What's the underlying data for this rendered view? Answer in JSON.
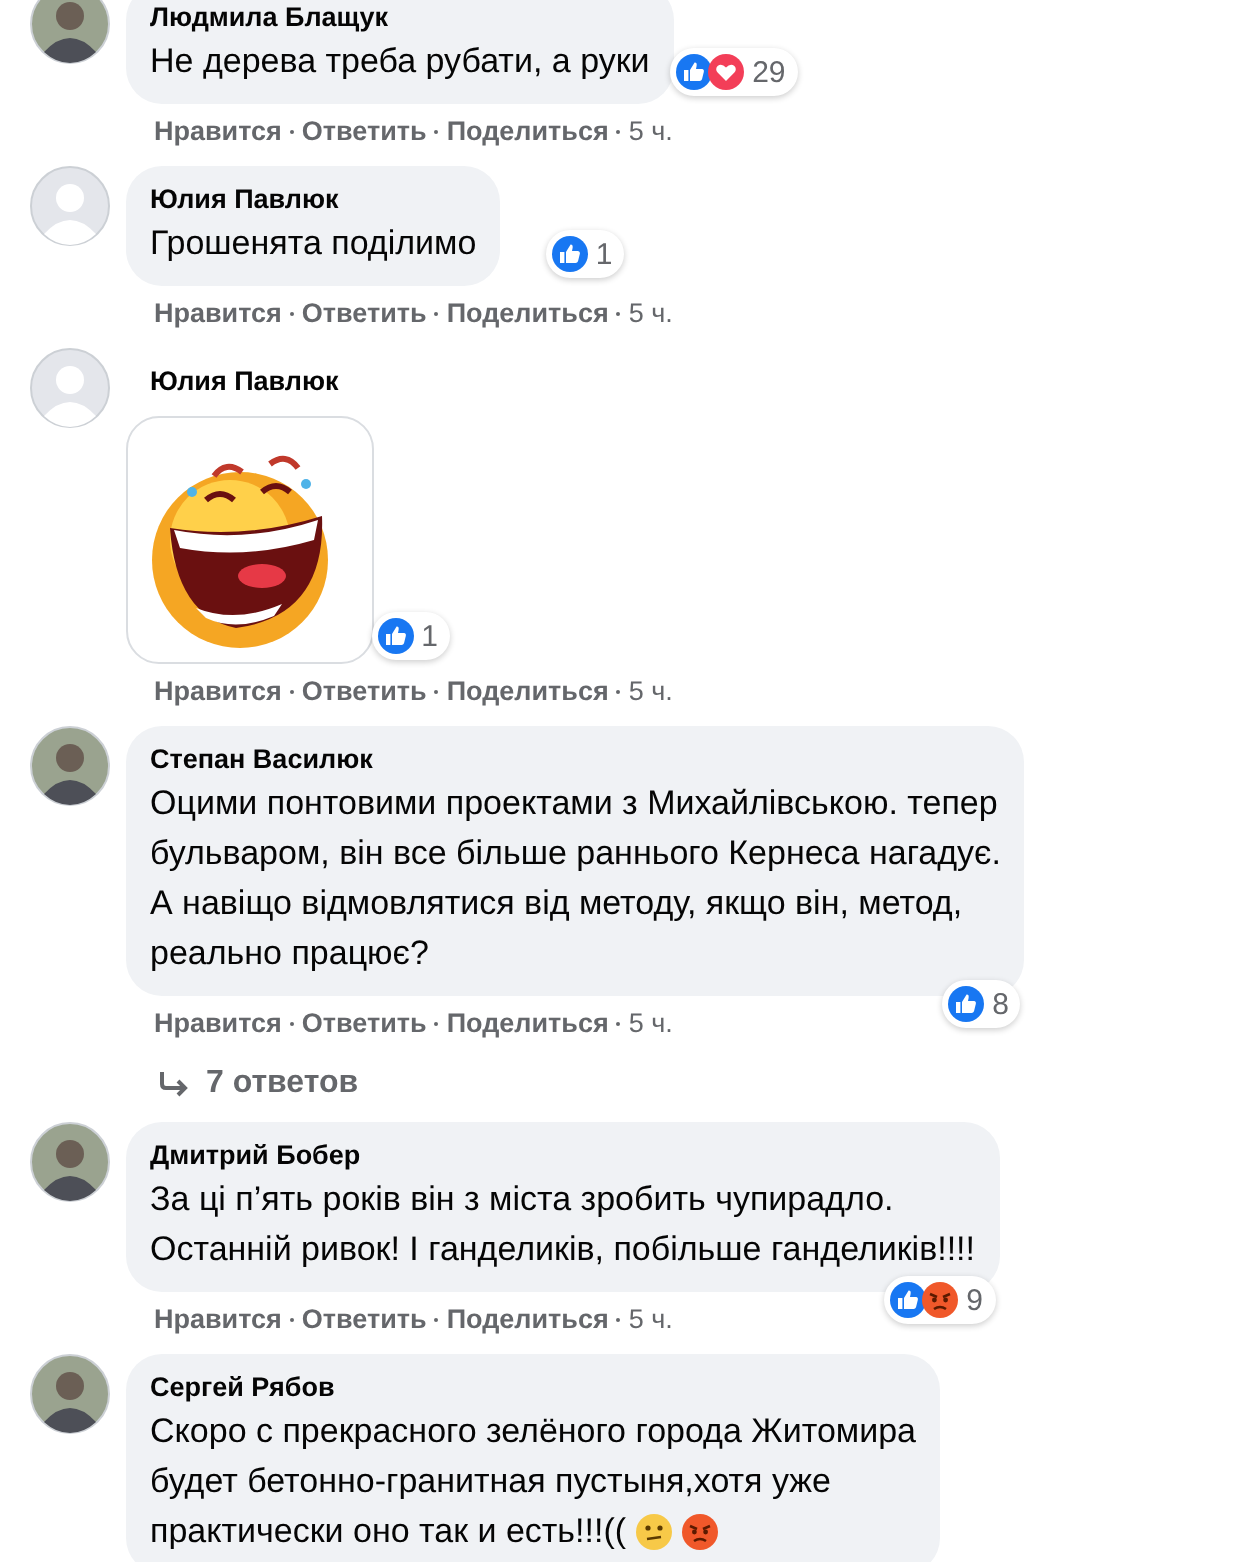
{
  "comments": [
    {
      "author": "Людмила Блащук",
      "avatar": {
        "kind": "photo"
      },
      "text": "Не дерева треба рубати, а руки",
      "reactions": [
        {
          "kind": "like"
        },
        {
          "kind": "love"
        }
      ],
      "reaction_count": "29",
      "actions": [
        "Нравится",
        "Ответить",
        "Поделиться"
      ],
      "time": "5 ч."
    },
    {
      "author": "Юлия Павлюк",
      "avatar": {
        "kind": "default"
      },
      "text": "Грошенята поділимо",
      "reactions": [
        {
          "kind": "like"
        }
      ],
      "reaction_count": "1",
      "actions": [
        "Нравится",
        "Ответить",
        "Поделиться"
      ],
      "time": "5 ч."
    },
    {
      "author": "Юлия Павлюк",
      "avatar": {
        "kind": "default"
      },
      "kind": "sticker",
      "reactions": [
        {
          "kind": "like"
        }
      ],
      "reaction_count": "1",
      "actions": [
        "Нравится",
        "Ответить",
        "Поделиться"
      ],
      "time": "5 ч."
    },
    {
      "author": "Степан Василюк",
      "avatar": {
        "kind": "photo"
      },
      "text": "Оцими понтовими проектами з Михайлівською. тепер\nбульваром, він все більше раннього Кернеса нагадує.\nА навіщо відмовлятися від методу, якщо він, метод,\nреально працює?",
      "reactions": [
        {
          "kind": "like"
        }
      ],
      "reaction_count": "8",
      "actions": [
        "Нравится",
        "Ответить",
        "Поделиться"
      ],
      "time": "5 ч.",
      "replies": "7 ответов"
    },
    {
      "author": "Дмитрий Бобер",
      "avatar": {
        "kind": "photo"
      },
      "text": "За ці п’ять років він з міста зробить чупирадло.\nОстанній ривок! І ганделиків, побільше ганделиків!!!!",
      "reactions": [
        {
          "kind": "like"
        },
        {
          "kind": "angry"
        }
      ],
      "reaction_count": "9",
      "actions": [
        "Нравится",
        "Ответить",
        "Поделиться"
      ],
      "time": "5 ч."
    },
    {
      "author": "Сергей Рябов",
      "avatar": {
        "kind": "photo"
      },
      "text": "Скоро с прекрасного зелёного города Житомира\nбудет бетонно-гранитная пустыня,хотя уже\nпрактически оно так и есть!!!((",
      "emojis": [
        {
          "kind": "confused"
        },
        {
          "kind": "angry"
        }
      ]
    }
  ]
}
